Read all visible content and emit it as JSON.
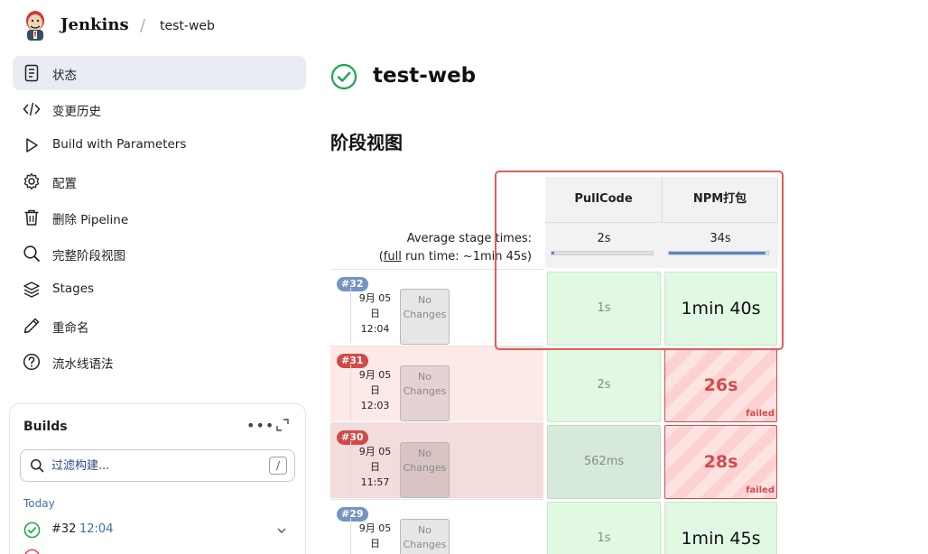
{
  "header": {
    "brand": "Jenkins",
    "separator": "/",
    "job": "test-web"
  },
  "sidebar": {
    "items": [
      {
        "label": "状态",
        "icon": "document-icon"
      },
      {
        "label": "变更历史",
        "icon": "code-icon"
      },
      {
        "label": "Build with Parameters",
        "icon": "play-icon"
      },
      {
        "label": "配置",
        "icon": "gear-icon"
      },
      {
        "label": "删除 Pipeline",
        "icon": "trash-icon"
      },
      {
        "label": "完整阶段视图",
        "icon": "search-icon"
      },
      {
        "label": "Stages",
        "icon": "layers-icon"
      },
      {
        "label": "重命名",
        "icon": "pencil-icon"
      },
      {
        "label": "流水线语法",
        "icon": "help-icon"
      }
    ]
  },
  "builds": {
    "title": "Builds",
    "more": "•••",
    "filter_placeholder": "过滤构建...",
    "filter_shortcut": "/",
    "group": "Today",
    "rows": [
      {
        "num": "#32",
        "time": "12:04"
      }
    ]
  },
  "main": {
    "title": "test-web",
    "section": "阶段视图"
  },
  "stage_view": {
    "avg_label": "Average stage times:",
    "full_run_prefix": "(",
    "full_link": "full",
    "full_run_suffix": " run time: ~1min 45s)",
    "stages": [
      {
        "name": "PullCode",
        "avg": "2s",
        "avg_fraction": 0.03
      },
      {
        "name": "NPM打包",
        "avg": "34s",
        "avg_fraction": 0.97
      }
    ],
    "runs": [
      {
        "id": "#32",
        "status": "success",
        "date_line1": "9月 05",
        "date_line2": "日",
        "time": "12:04",
        "changes_line1": "No",
        "changes_line2": "Changes",
        "cells": [
          {
            "text": "1s",
            "state": "ok"
          },
          {
            "text": "1min 40s",
            "state": "ok"
          }
        ]
      },
      {
        "id": "#31",
        "status": "failed",
        "date_line1": "9月 05",
        "date_line2": "日",
        "time": "12:03",
        "changes_line1": "No",
        "changes_line2": "Changes",
        "cells": [
          {
            "text": "2s",
            "state": "ok"
          },
          {
            "text": "26s",
            "state": "fail",
            "tag": "failed"
          }
        ]
      },
      {
        "id": "#30",
        "status": "failed",
        "date_line1": "9月 05",
        "date_line2": "日",
        "time": "11:57",
        "changes_line1": "No",
        "changes_line2": "Changes",
        "cells": [
          {
            "text": "562ms",
            "state": "ok"
          },
          {
            "text": "28s",
            "state": "fail",
            "tag": "failed"
          }
        ]
      },
      {
        "id": "#29",
        "status": "success",
        "date_line1": "9月 05",
        "date_line2": "日",
        "time": "",
        "changes_line1": "No",
        "changes_line2": "Changes",
        "cells": [
          {
            "text": "1s",
            "state": "ok"
          },
          {
            "text": "1min 45s",
            "state": "ok"
          }
        ]
      }
    ]
  },
  "colors": {
    "success": "#1ea64b",
    "failure": "#d34b4a",
    "accent": "#3b6fb0"
  }
}
